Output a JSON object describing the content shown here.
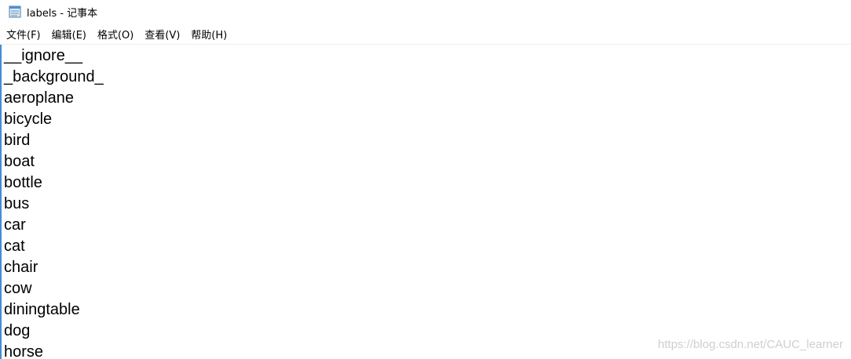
{
  "window": {
    "title": "labels - 记事本"
  },
  "menu": {
    "items": [
      "文件(F)",
      "编辑(E)",
      "格式(O)",
      "查看(V)",
      "帮助(H)"
    ]
  },
  "editor": {
    "lines": [
      "__ignore__",
      "_background_",
      "aeroplane",
      "bicycle",
      "bird",
      "boat",
      "bottle",
      "bus",
      "car",
      "cat",
      "chair",
      "cow",
      "diningtable",
      "dog",
      "horse"
    ]
  },
  "watermark": "https://blog.csdn.net/CAUC_learner"
}
